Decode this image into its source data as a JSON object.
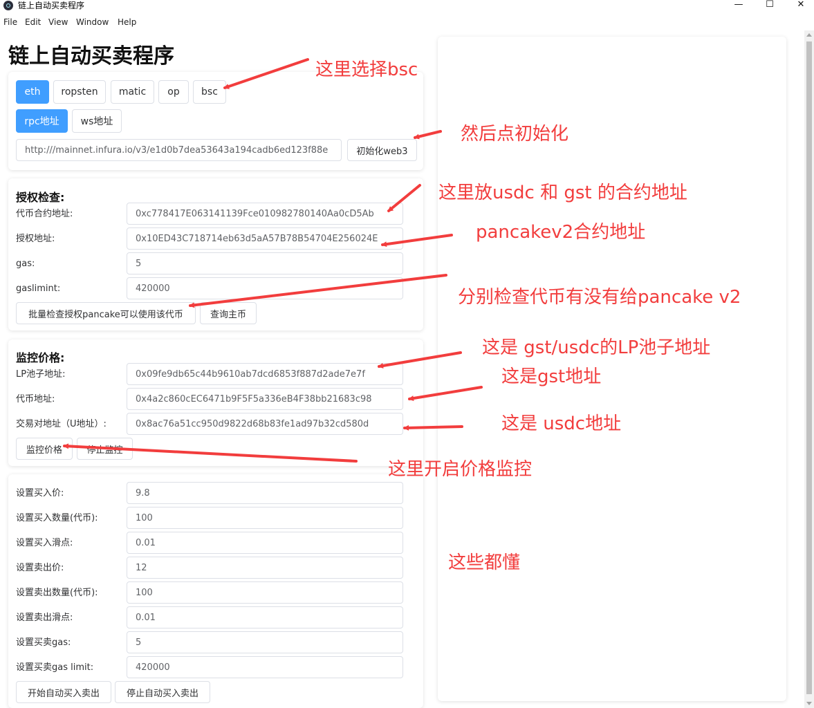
{
  "window": {
    "title": "链上自动买卖程序",
    "controls": {
      "minimize": "—",
      "maximize": "☐",
      "close": "✕"
    }
  },
  "menu": [
    "File",
    "Edit",
    "View",
    "Window",
    "Help"
  ],
  "page_title": "链上自动买卖程序",
  "network": {
    "chains": [
      "eth",
      "ropsten",
      "matic",
      "op",
      "bsc"
    ],
    "selected_chain": "eth",
    "url_types": [
      "rpc地址",
      "ws地址"
    ],
    "selected_url_type": "rpc地址",
    "url_value": "http:///mainnet.infura.io/v3/e1d0b7dea53643a194cadb6ed123f88e",
    "init_button": "初始化web3"
  },
  "approval": {
    "title": "授权检查:",
    "fields": [
      {
        "label": "代币合约地址:",
        "value": "0xc778417E063141139Fce010982780140Aa0cD5Ab"
      },
      {
        "label": "授权地址:",
        "value": "0x10ED43C718714eb63d5aA57B78B54704E256024E"
      },
      {
        "label": "gas:",
        "value": "5"
      },
      {
        "label": "gaslimint:",
        "value": "420000"
      }
    ],
    "check_button": "批量检查授权pancake可以使用该代币",
    "query_button": "查询主币"
  },
  "monitor": {
    "title": "监控价格:",
    "fields": [
      {
        "label": "LP池子地址:",
        "value": "0x09fe9db65c44b9610ab7dcd6853f887d2ade7e7f"
      },
      {
        "label": "代币地址:",
        "value": "0x4a2c860cEC6471b9F5F5a336eB4F38bb21683c98"
      },
      {
        "label": "交易对地址（U地址）:",
        "value": "0x8ac76a51cc950d9822d68b83fe1ad97b32cd580d"
      }
    ],
    "start_button": "监控价格",
    "stop_button": "停止监控"
  },
  "trade": {
    "fields": [
      {
        "label": "设置买入价:",
        "value": "9.8"
      },
      {
        "label": "设置买入数量(代币):",
        "value": "100"
      },
      {
        "label": "设置买入滑点:",
        "value": "0.01"
      },
      {
        "label": "设置卖出价:",
        "value": "12"
      },
      {
        "label": "设置卖出数量(代币):",
        "value": "100"
      },
      {
        "label": "设置卖出滑点:",
        "value": "0.01"
      },
      {
        "label": "设置买卖gas:",
        "value": "5"
      },
      {
        "label": "设置买卖gas limit:",
        "value": "420000"
      }
    ],
    "start_button": "开始自动买入卖出",
    "stop_button": "停止自动买入卖出"
  },
  "annotations": [
    "这里选择bsc",
    "然后点初始化",
    "这里放usdc 和 gst 的合约地址",
    "pancakev2合约地址",
    "分别检查代币有没有给pancake v2",
    "这是 gst/usdc的LP池子地址",
    "这是gst地址",
    "这是 usdc地址",
    "这里开启价格监控",
    "这些都懂"
  ],
  "colors": {
    "primary": "#409eff",
    "annotation": "#f23d3d",
    "border": "#dcdfe6"
  }
}
